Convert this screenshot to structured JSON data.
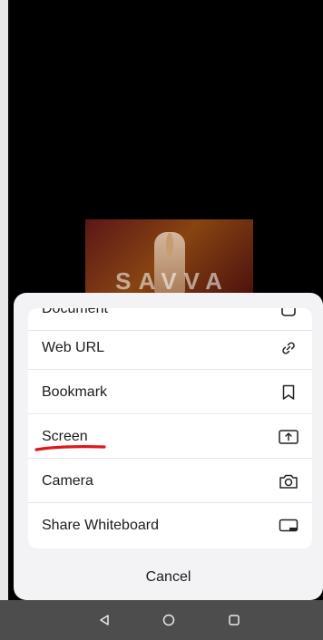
{
  "share_sheet": {
    "options": [
      {
        "label": "Document",
        "icon": "document-icon"
      },
      {
        "label": "Web URL",
        "icon": "link-icon"
      },
      {
        "label": "Bookmark",
        "icon": "bookmark-icon"
      },
      {
        "label": "Screen",
        "icon": "screen-share-icon"
      },
      {
        "label": "Camera",
        "icon": "camera-icon"
      },
      {
        "label": "Share Whiteboard",
        "icon": "whiteboard-icon"
      }
    ],
    "cancel_label": "Cancel",
    "annotation_color": "#e0161b"
  },
  "background": {
    "video_logo": "SAVVA"
  },
  "navbar": {
    "buttons": [
      "back-icon",
      "home-icon",
      "recents-icon"
    ]
  }
}
